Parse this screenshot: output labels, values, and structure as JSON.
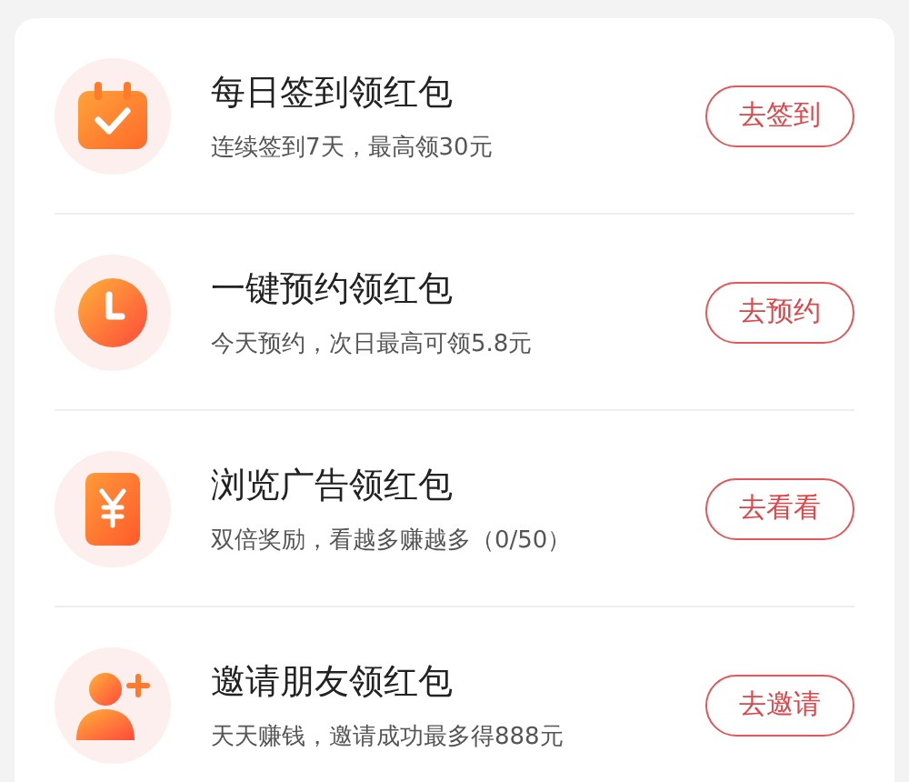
{
  "tasks": [
    {
      "kind": "calendar",
      "title": "每日签到领红包",
      "subtitle": "连续签到7天，最高领30元",
      "action": "去签到"
    },
    {
      "kind": "clock",
      "title": "一键预约领红包",
      "subtitle": "今天预约，次日最高可领5.8元",
      "action": "去预约"
    },
    {
      "kind": "money",
      "title": "浏览广告领红包",
      "subtitle": "双倍奖励，看越多赚越多（0/50）",
      "action": "去看看"
    },
    {
      "kind": "invite",
      "title": "邀请朋友领红包",
      "subtitle": "天天赚钱，邀请成功最多得888元",
      "action": "去邀请"
    }
  ]
}
